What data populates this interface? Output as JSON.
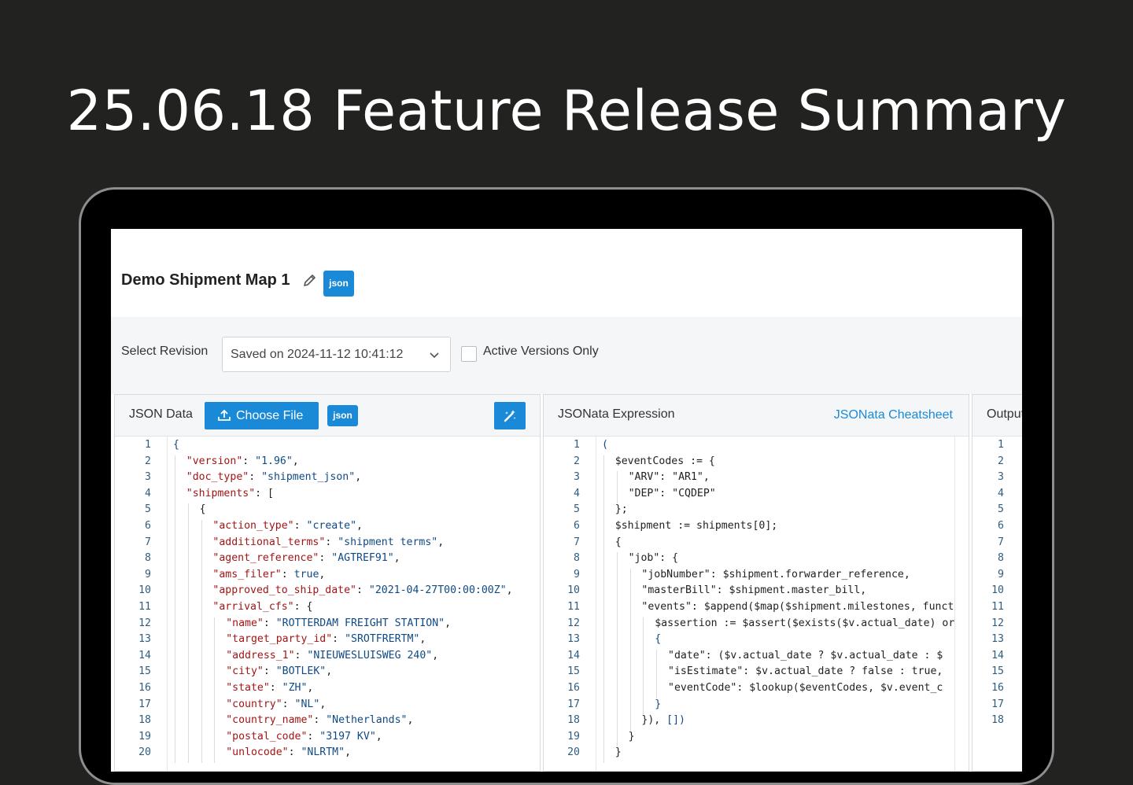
{
  "page": {
    "headline": "25.06.18 Feature Release Summary"
  },
  "header": {
    "map_title": "Demo Shipment Map 1",
    "badge": "json"
  },
  "revision": {
    "label": "Select Revision",
    "selected": "Saved on 2024-11-12 10:41:12",
    "checkbox_label": "Active Versions Only"
  },
  "json_panel": {
    "title": "JSON Data",
    "choose_file_label": "Choose File",
    "badge": "json",
    "lines": [
      [
        {
          "t": "{",
          "c": "b"
        }
      ],
      [
        {
          "t": "\"version\"",
          "c": "k"
        },
        {
          "t": ": ",
          "c": "p"
        },
        {
          "t": "\"1.96\"",
          "c": "s"
        },
        {
          "t": ",",
          "c": "p"
        }
      ],
      [
        {
          "t": "\"doc_type\"",
          "c": "k"
        },
        {
          "t": ": ",
          "c": "p"
        },
        {
          "t": "\"shipment_json\"",
          "c": "s"
        },
        {
          "t": ",",
          "c": "p"
        }
      ],
      [
        {
          "t": "\"shipments\"",
          "c": "k"
        },
        {
          "t": ": [",
          "c": "p"
        }
      ],
      [
        {
          "t": "{",
          "c": "p"
        }
      ],
      [
        {
          "t": "\"action_type\"",
          "c": "k"
        },
        {
          "t": ": ",
          "c": "p"
        },
        {
          "t": "\"create\"",
          "c": "s"
        },
        {
          "t": ",",
          "c": "p"
        }
      ],
      [
        {
          "t": "\"additional_terms\"",
          "c": "k"
        },
        {
          "t": ": ",
          "c": "p"
        },
        {
          "t": "\"shipment terms\"",
          "c": "s"
        },
        {
          "t": ",",
          "c": "p"
        }
      ],
      [
        {
          "t": "\"agent_reference\"",
          "c": "k"
        },
        {
          "t": ": ",
          "c": "p"
        },
        {
          "t": "\"AGTREF91\"",
          "c": "s"
        },
        {
          "t": ",",
          "c": "p"
        }
      ],
      [
        {
          "t": "\"ams_filer\"",
          "c": "k"
        },
        {
          "t": ": ",
          "c": "p"
        },
        {
          "t": "true",
          "c": "s"
        },
        {
          "t": ",",
          "c": "p"
        }
      ],
      [
        {
          "t": "\"approved_to_ship_date\"",
          "c": "k"
        },
        {
          "t": ": ",
          "c": "p"
        },
        {
          "t": "\"2021-04-27T00:00:00Z\"",
          "c": "s"
        },
        {
          "t": ",",
          "c": "p"
        }
      ],
      [
        {
          "t": "\"arrival_cfs\"",
          "c": "k"
        },
        {
          "t": ": {",
          "c": "p"
        }
      ],
      [
        {
          "t": "\"name\"",
          "c": "k"
        },
        {
          "t": ": ",
          "c": "p"
        },
        {
          "t": "\"ROTTERDAM FREIGHT STATION\"",
          "c": "s"
        },
        {
          "t": ",",
          "c": "p"
        }
      ],
      [
        {
          "t": "\"target_party_id\"",
          "c": "k"
        },
        {
          "t": ": ",
          "c": "p"
        },
        {
          "t": "\"SROTFRERTM\"",
          "c": "s"
        },
        {
          "t": ",",
          "c": "p"
        }
      ],
      [
        {
          "t": "\"address_1\"",
          "c": "k"
        },
        {
          "t": ": ",
          "c": "p"
        },
        {
          "t": "\"NIEUWESLUISWEG 240\"",
          "c": "s"
        },
        {
          "t": ",",
          "c": "p"
        }
      ],
      [
        {
          "t": "\"city\"",
          "c": "k"
        },
        {
          "t": ": ",
          "c": "p"
        },
        {
          "t": "\"BOTLEK\"",
          "c": "s"
        },
        {
          "t": ",",
          "c": "p"
        }
      ],
      [
        {
          "t": "\"state\"",
          "c": "k"
        },
        {
          "t": ": ",
          "c": "p"
        },
        {
          "t": "\"ZH\"",
          "c": "s"
        },
        {
          "t": ",",
          "c": "p"
        }
      ],
      [
        {
          "t": "\"country\"",
          "c": "k"
        },
        {
          "t": ": ",
          "c": "p"
        },
        {
          "t": "\"NL\"",
          "c": "s"
        },
        {
          "t": ",",
          "c": "p"
        }
      ],
      [
        {
          "t": "\"country_name\"",
          "c": "k"
        },
        {
          "t": ": ",
          "c": "p"
        },
        {
          "t": "\"Netherlands\"",
          "c": "s"
        },
        {
          "t": ",",
          "c": "p"
        }
      ],
      [
        {
          "t": "\"postal_code\"",
          "c": "k"
        },
        {
          "t": ": ",
          "c": "p"
        },
        {
          "t": "\"3197 KV\"",
          "c": "s"
        },
        {
          "t": ",",
          "c": "p"
        }
      ],
      [
        {
          "t": "\"unlocode\"",
          "c": "k"
        },
        {
          "t": ": ",
          "c": "p"
        },
        {
          "t": "\"NLRTM\"",
          "c": "s"
        },
        {
          "t": ",",
          "c": "p"
        }
      ]
    ],
    "indent": [
      0,
      1,
      1,
      1,
      2,
      3,
      3,
      3,
      3,
      3,
      3,
      4,
      4,
      4,
      4,
      4,
      4,
      4,
      4,
      4
    ]
  },
  "expr_panel": {
    "title": "JSONata Expression",
    "link": "JSONata Cheatsheet",
    "lines": [
      [
        {
          "t": "(",
          "c": "b"
        }
      ],
      [
        {
          "t": "$eventCodes := ",
          "c": "p"
        },
        {
          "t": "{",
          "c": "p"
        }
      ],
      [
        {
          "t": "\"ARV\": \"AR1\",",
          "c": "p"
        }
      ],
      [
        {
          "t": "\"DEP\": \"CQDEP\"",
          "c": "p"
        }
      ],
      [
        {
          "t": "};",
          "c": "p"
        }
      ],
      [
        {
          "t": "$shipment := shipments[0];",
          "c": "p"
        }
      ],
      [
        {
          "t": "{",
          "c": "p"
        }
      ],
      [
        {
          "t": "\"job\": {",
          "c": "p"
        }
      ],
      [
        {
          "t": "\"jobNumber\": $shipment.forwarder_reference,",
          "c": "p"
        }
      ],
      [
        {
          "t": "\"masterBill\": $shipment.master_bill,",
          "c": "p"
        }
      ],
      [
        {
          "t": "\"events\": $append($map($shipment.milestones, funct",
          "c": "p"
        }
      ],
      [
        {
          "t": "$assertion := $assert($exists($v.actual_date) or",
          "c": "p"
        }
      ],
      [
        {
          "t": "{",
          "c": "b"
        }
      ],
      [
        {
          "t": "\"date\": ($v.actual_date ? $v.actual_date : $",
          "c": "p"
        }
      ],
      [
        {
          "t": "\"isEstimate\": $v.actual_date ? false : true,",
          "c": "p"
        }
      ],
      [
        {
          "t": "\"eventCode\": $lookup($eventCodes, $v.event_c",
          "c": "p"
        }
      ],
      [
        {
          "t": "}",
          "c": "b"
        }
      ],
      [
        {
          "t": "}), ",
          "c": "p"
        },
        {
          "t": "[])",
          "c": "b"
        }
      ],
      [
        {
          "t": "}",
          "c": "p"
        }
      ],
      [
        {
          "t": "}",
          "c": "p"
        }
      ]
    ],
    "indent": [
      0,
      1,
      2,
      2,
      1,
      1,
      1,
      2,
      3,
      3,
      3,
      4,
      4,
      5,
      5,
      5,
      4,
      3,
      2,
      1
    ]
  },
  "output_panel": {
    "title": "Output",
    "line_count": 18
  }
}
